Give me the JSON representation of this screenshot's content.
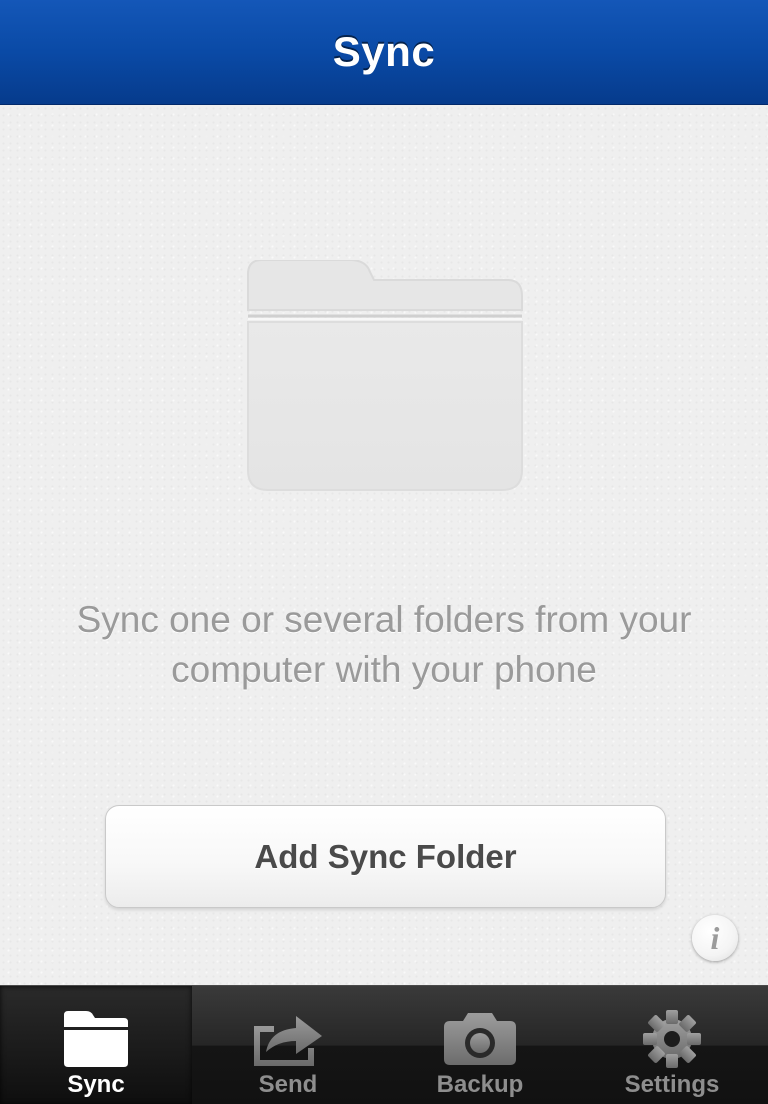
{
  "navbar": {
    "title": "Sync"
  },
  "content": {
    "message": "Sync one or several folders from your computer with your phone",
    "add_button_label": "Add Sync Folder",
    "info_label": "i"
  },
  "tabs": [
    {
      "label": "Sync",
      "icon": "folder-icon",
      "active": true
    },
    {
      "label": "Send",
      "icon": "share-icon",
      "active": false
    },
    {
      "label": "Backup",
      "icon": "camera-icon",
      "active": false
    },
    {
      "label": "Settings",
      "icon": "gear-icon",
      "active": false
    }
  ],
  "colors": {
    "navbar": "#0a4aa6",
    "background": "#efefef",
    "message_text": "#9a9a9a",
    "tab_active_label": "#ffffff",
    "tab_inactive_label": "#8e8e8e"
  }
}
